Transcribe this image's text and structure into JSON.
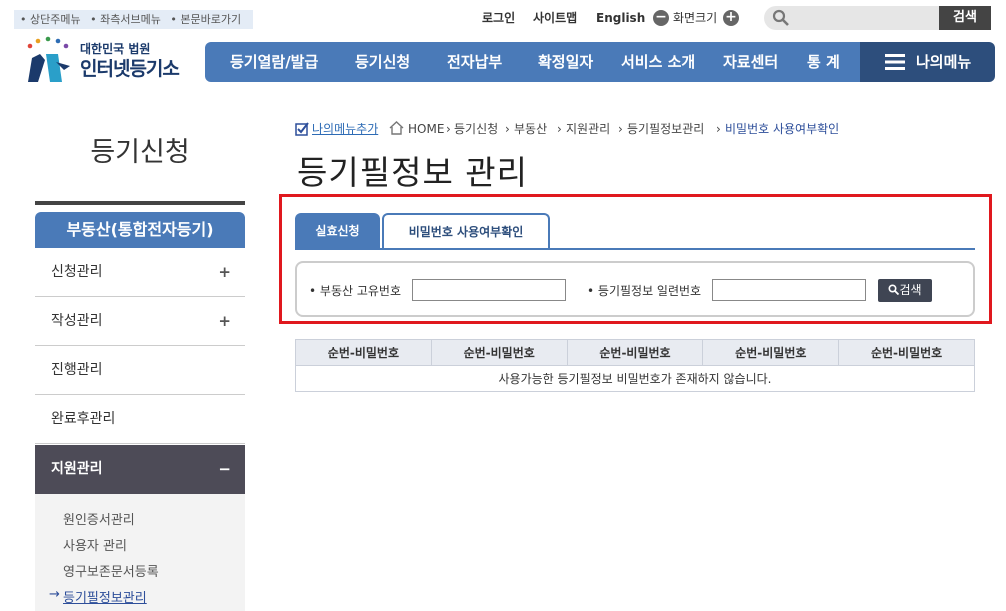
{
  "skip_links": [
    "상단주메뉴",
    "좌측서브메뉴",
    "본문바로가기"
  ],
  "util": {
    "login": "로그인",
    "sitemap": "사이트맵",
    "english": "English",
    "zoom_label": "화면크기",
    "search_button": "검색"
  },
  "logo": {
    "small": "대한민국 법원",
    "big": "인터넷등기소"
  },
  "gnb": [
    "등기열람/발급",
    "등기신청",
    "전자납부",
    "확정일자",
    "서비스 소개",
    "자료센터",
    "통 계"
  ],
  "mymenu": "나의메뉴",
  "sidebar": {
    "title": "등기신청",
    "section": "부동산(통합전자등기)",
    "items": [
      {
        "label": "신청관리",
        "sign": "+"
      },
      {
        "label": "작성관리",
        "sign": "+"
      },
      {
        "label": "진행관리",
        "sign": ""
      },
      {
        "label": "완료후관리",
        "sign": ""
      },
      {
        "label": "지원관리",
        "sign": "−"
      }
    ],
    "sub_items": [
      "원인증서관리",
      "사용자 관리",
      "영구보존문서등록",
      "등기필정보관리"
    ],
    "current_marker": "→"
  },
  "breadcrumb": {
    "add_menu": "나의메뉴추가",
    "path": [
      "HOME",
      "등기신청",
      "부동산",
      "지원관리",
      "등기필정보관리",
      "비밀번호 사용여부확인"
    ]
  },
  "page_title": "등기필정보 관리",
  "tabs": [
    "실효신청",
    "비밀번호 사용여부확인"
  ],
  "form": {
    "label1": "부동산 고유번호",
    "label2": "등기필정보 일련번호",
    "button": "검색",
    "value1": "",
    "value2": ""
  },
  "table": {
    "headers": [
      "순번-비밀번호",
      "순번-비밀번호",
      "순번-비밀번호",
      "순번-비밀번호",
      "순번-비밀번호"
    ],
    "empty_message": "사용가능한 등기필정보 비밀번호가 존재하지 않습니다."
  }
}
